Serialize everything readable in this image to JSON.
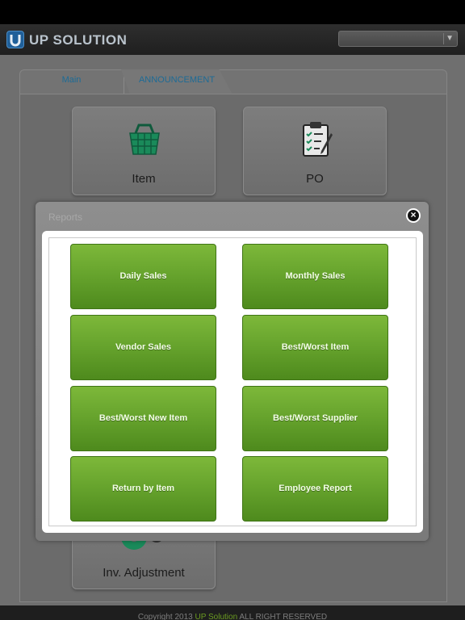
{
  "header": {
    "logo_letter": "U",
    "logo_text": "UP SOLUTION",
    "select_value": ""
  },
  "tabs": [
    {
      "label": "Main"
    },
    {
      "label": "ANNOUNCEMENT"
    }
  ],
  "tiles": {
    "item": "Item",
    "po": "PO",
    "inv_adjustment": "Inv. Adjustment"
  },
  "dialog": {
    "title": "Reports",
    "close_glyph": "×",
    "buttons": [
      "Daily Sales",
      "Monthly Sales",
      "Vendor Sales",
      "Best/Worst Item",
      "Best/Worst New Item",
      "Best/Worst Supplier",
      "Return by Item",
      "Employee Report"
    ]
  },
  "footer": {
    "prefix": "Copyright 2013 ",
    "brand": "UP Solution",
    "suffix": " ALL RIGHT RESERVED"
  },
  "colors": {
    "button_green": "#65a22c",
    "brand_blue": "#1f5f99",
    "tab_text": "#1d6b96"
  }
}
